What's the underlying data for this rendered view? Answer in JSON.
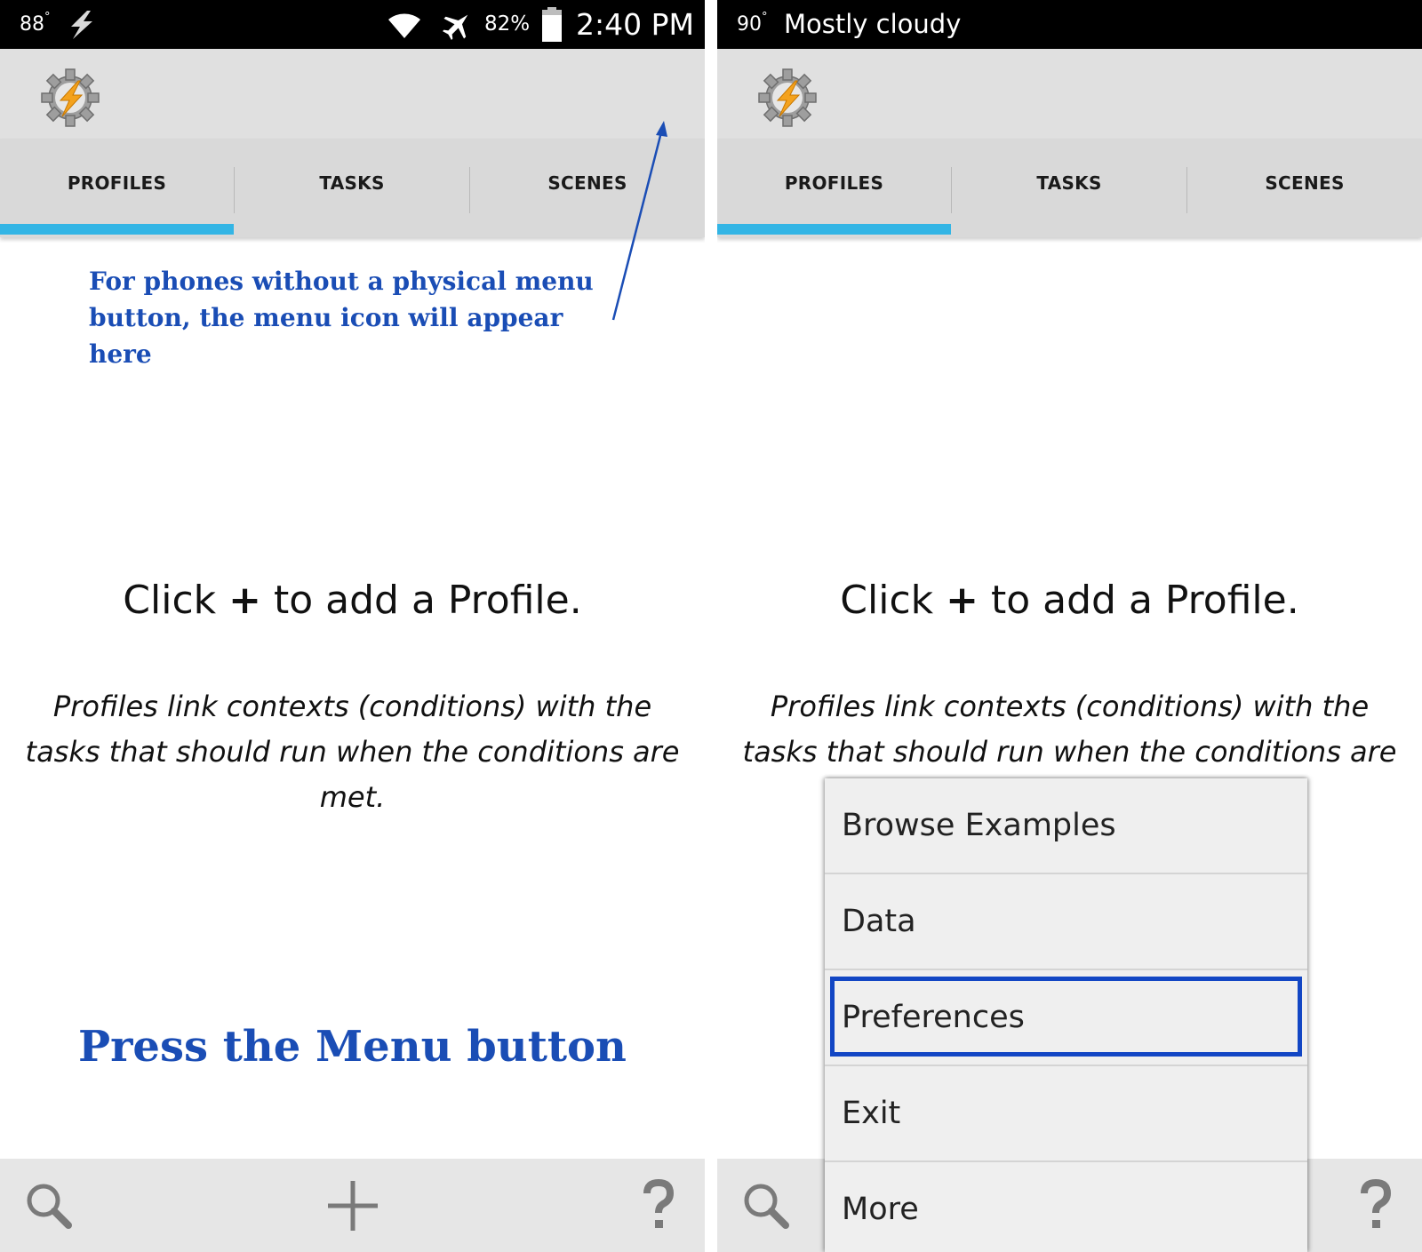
{
  "left_screen": {
    "status_bar": {
      "temperature": "88",
      "temperature_unit": "°",
      "icons_left": [
        "lightning-bolt-icon"
      ],
      "icons_right": [
        "wifi-icon",
        "airplane-icon",
        "battery-icon"
      ],
      "battery_percent": "82%",
      "time": "2:40 PM"
    },
    "action_bar": {
      "app_icon": "tasker-gear-lightning-icon"
    },
    "tabs": [
      {
        "label": "PROFILES",
        "selected": true
      },
      {
        "label": "TASKS",
        "selected": false
      },
      {
        "label": "SCENES",
        "selected": false
      }
    ],
    "annotation": {
      "line1": "For phones without a physical menu",
      "line2": "button, the menu icon will appear here"
    },
    "empty_state": {
      "title_before": "Click ",
      "title_plus": "+",
      "title_after": " to add a Profile.",
      "description": "Profiles link contexts (conditions) with the tasks that should run when the conditions are met."
    },
    "instruction": "Press the Menu button",
    "bottom_bar": {
      "icons": [
        "search-icon",
        "add-icon",
        "help-icon"
      ]
    }
  },
  "right_screen": {
    "status_bar": {
      "temperature": "90",
      "temperature_unit": "°",
      "weather": "Mostly cloudy"
    },
    "action_bar": {
      "app_icon": "tasker-gear-lightning-icon"
    },
    "tabs": [
      {
        "label": "PROFILES",
        "selected": true
      },
      {
        "label": "TASKS",
        "selected": false
      },
      {
        "label": "SCENES",
        "selected": false
      }
    ],
    "empty_state": {
      "title_before": "Click ",
      "title_plus": "+",
      "title_after": " to add a Profile.",
      "description": "Profiles link contexts (conditions) with the tasks that should run when the conditions are"
    },
    "menu": {
      "items": [
        "Browse Examples",
        "Data",
        "Preferences",
        "Exit",
        "More"
      ],
      "highlighted": "Preferences"
    },
    "bottom_bar": {
      "icons": [
        "search-icon",
        "help-icon"
      ]
    }
  },
  "colors": {
    "accent_tab_indicator": "#33b5e5",
    "annotation_blue": "#1a4db5",
    "highlight_border": "#1246c4",
    "status_bar": "#000000",
    "action_bar": "#e0e0e0"
  }
}
